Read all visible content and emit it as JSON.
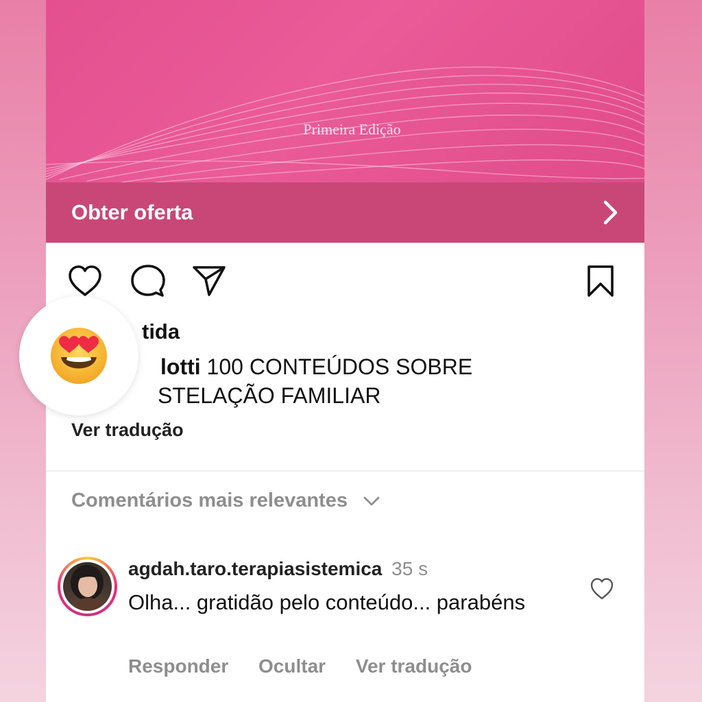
{
  "ad": {
    "hero_caption": "Primeira Edição",
    "cta_label": "Obter oferta",
    "colors": {
      "cta_bg": "#c94777",
      "hero_bg": "#e4508f"
    }
  },
  "post": {
    "actions": [
      "heart-icon",
      "comment-icon",
      "share-icon",
      "bookmark-icon"
    ],
    "caption_username": "tida",
    "caption_author": "lotti",
    "caption_text_line1": "100 CONTEÚDOS SOBRE",
    "caption_text_line2": "STELAÇÃO FAMILIAR",
    "see_translation": "Ver tradução"
  },
  "comments": {
    "sort_label": "Comentários mais relevantes",
    "items": [
      {
        "username": "agdah.taro.terapiasistemica",
        "time": "35 s",
        "text": "Olha... gratidão pelo conteúdo... parabéns",
        "reply_label": "Responder",
        "hide_label": "Ocultar",
        "translate_label": "Ver tradução"
      }
    ]
  },
  "overlay": {
    "reaction_emoji": "smiling-face-with-heart-eyes"
  }
}
